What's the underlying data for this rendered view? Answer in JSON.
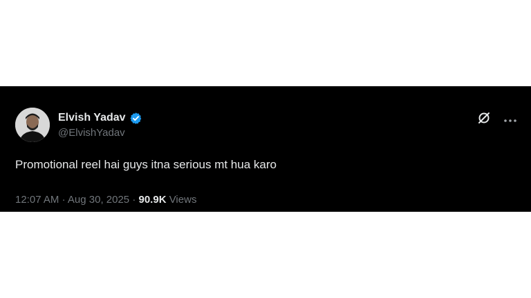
{
  "author": {
    "display_name": "Elvish Yadav",
    "handle": "@ElvishYadav",
    "verified_icon": "verified-badge-icon",
    "avatar_icon": "avatar"
  },
  "actions": {
    "grok_icon": "grok-icon",
    "more_icon": "more-icon"
  },
  "tweet": {
    "text": "Promotional reel hai guys itna serious mt hua karo",
    "time": "12:07 AM",
    "separator": "·",
    "date": "Aug 30, 2025",
    "views_count": "90.9K",
    "views_label": "Views"
  },
  "colors": {
    "background": "#000000",
    "text_primary": "#e7e9ea",
    "text_secondary": "#71767b",
    "verified_blue": "#1d9bf0"
  }
}
